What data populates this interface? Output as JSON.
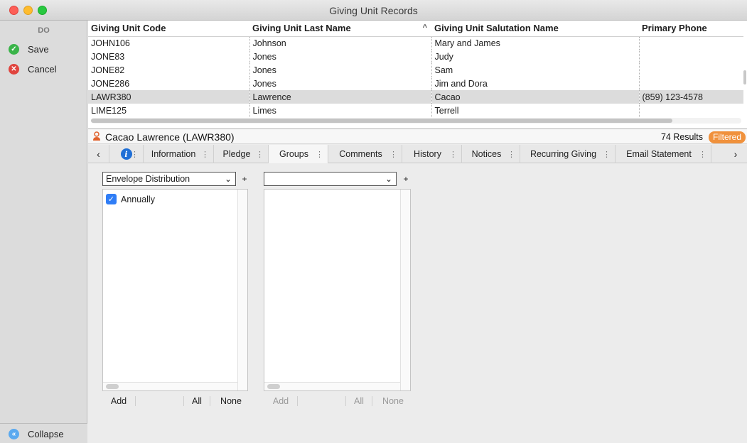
{
  "window": {
    "title": "Giving Unit Records"
  },
  "sidebar": {
    "header": "DO",
    "save_label": "Save",
    "cancel_label": "Cancel",
    "collapse_label": "Collapse"
  },
  "table": {
    "columns": [
      "Giving Unit Code",
      "Giving Unit Last Name",
      "Giving Unit Salutation Name",
      "Primary Phone"
    ],
    "rows": [
      [
        "JOHN106",
        "Johnson",
        "Mary and James",
        ""
      ],
      [
        "JONE83",
        "Jones",
        "Judy",
        ""
      ],
      [
        "JONE82",
        "Jones",
        "Sam",
        ""
      ],
      [
        "JONE286",
        "Jones",
        "Jim and Dora",
        ""
      ],
      [
        "LAWR380",
        "Lawrence",
        "Cacao",
        "(859) 123-4578"
      ],
      [
        "LIME125",
        "Limes",
        "Terrell",
        ""
      ]
    ],
    "sort_indicator": "^"
  },
  "record": {
    "name": "Cacao Lawrence (LAWR380)",
    "results": "74 Results",
    "filter_badge": "Filtered"
  },
  "tabs": {
    "prev": "‹",
    "next": "›",
    "items": [
      "Information",
      "Pledge",
      "Groups",
      "Comments",
      "History",
      "Notices",
      "Recurring Giving",
      "Email Statement"
    ],
    "active": "Groups"
  },
  "groups": {
    "left": {
      "select_value": "Envelope Distribution",
      "items": [
        {
          "label": "Annually",
          "checked": true
        }
      ],
      "add_label": "Add",
      "all_label": "All",
      "none_label": "None"
    },
    "right": {
      "select_value": "",
      "add_label": "Add",
      "all_label": "All",
      "none_label": "None"
    },
    "plus_label": "+"
  },
  "colors": {
    "accent": "#2f7df6",
    "badge": "#f0913c",
    "save": "#3ab449",
    "cancel": "#e0443e"
  }
}
